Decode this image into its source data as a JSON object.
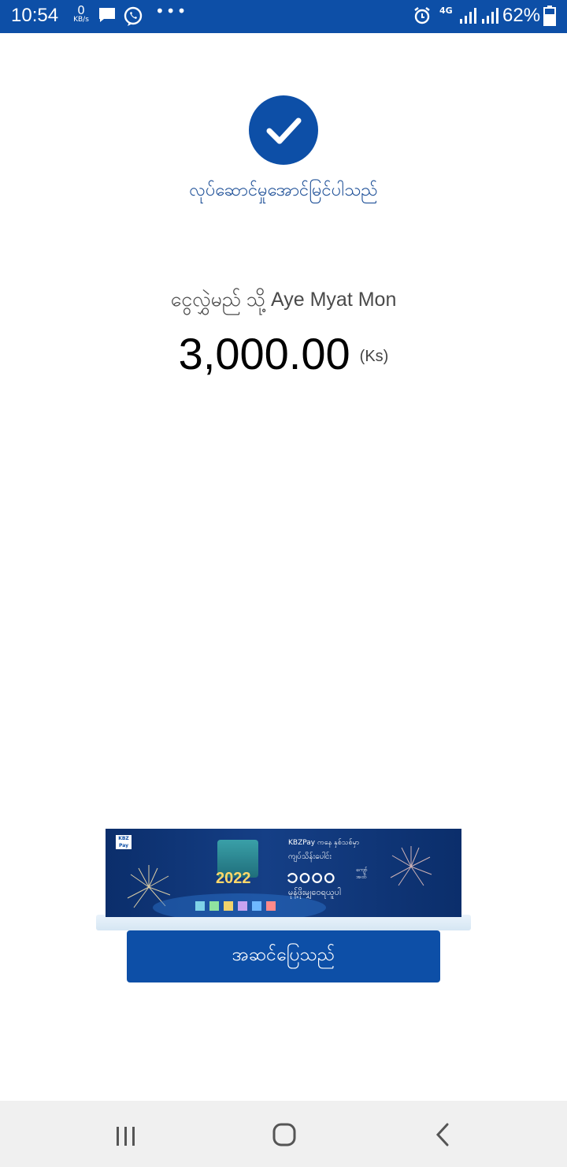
{
  "status_bar": {
    "time": "10:54",
    "speed_value": "0",
    "speed_unit": "KB/s",
    "more": "•••",
    "network": "4G",
    "battery": "62%"
  },
  "result": {
    "status_text": "လုပ်ဆောင်မှုအောင်မြင်ပါသည်",
    "recipient_line": "ငွေလွှဲမည် သို့ Aye Myat Mon",
    "amount": "3,000.00",
    "currency": "(Ks)"
  },
  "banner": {
    "logo_line1": "KBZ",
    "logo_line2": "Pay",
    "line1": "KBZPay ကနေ နှစ်သစ်မှာ",
    "line2": "ကျပ်သိန်းပေါင်း",
    "big_number": "၁၀၀၀",
    "unit_line1": "ကျော်",
    "unit_line2": "အထိ",
    "line3": "မုန့်ဖိုးမျှဝေရယူပါ",
    "year": "2022"
  },
  "actions": {
    "done_label": "အဆင်ပြေသည်"
  },
  "colors": {
    "primary": "#0d4fa7",
    "status_text": "#1d4f97",
    "nav_bg": "#f0f0f0"
  }
}
